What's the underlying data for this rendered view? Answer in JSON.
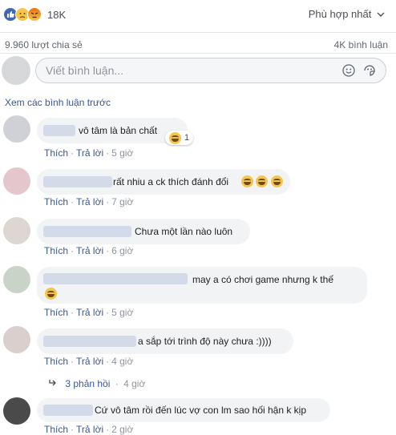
{
  "post": {
    "reaction_count": "18K",
    "sort_label": "Phù hợp nhất",
    "shares": "9.960 lượt chia sẻ",
    "comments": "4K bình luận"
  },
  "composer": {
    "placeholder": "Viết bình luận..."
  },
  "view_previous": "Xem các bình luận trước",
  "comments": [
    {
      "text": "vô tâm là bản chất",
      "like": "Thích",
      "reply": "Trả lời",
      "time": "5 giờ",
      "reaction_count": "1"
    },
    {
      "text": "rất nhiu a ck thích đánh đổi",
      "like": "Thích",
      "reply": "Trả lời",
      "time": "7 giờ"
    },
    {
      "text": "Chưa một lần nào luôn",
      "like": "Thích",
      "reply": "Trả lời",
      "time": "6 giờ"
    },
    {
      "text": "may a có chơi game nhưng k thế",
      "like": "Thích",
      "reply": "Trả lời",
      "time": "5 giờ"
    },
    {
      "text": "a sắp tới trình độ này chưa :))))",
      "like": "Thích",
      "reply": "Trả lời",
      "time": "4 giờ",
      "replies": "3 phản hồi",
      "replies_time": "4 giờ"
    },
    {
      "text": "Cứ vô tâm rồi đến lúc vợ con lm sao hối hận k kịp",
      "like": "Thích",
      "reply": "Trả lời",
      "time": "2 giờ"
    }
  ],
  "colors": {
    "link": "#385898",
    "like": "#4267b2",
    "bubble": "#f2f3f5"
  },
  "icons": [
    "like-icon",
    "sad-icon",
    "angry-icon",
    "chevron-down-icon",
    "emoji-icon",
    "sticker-icon",
    "reply-arrow-icon"
  ]
}
